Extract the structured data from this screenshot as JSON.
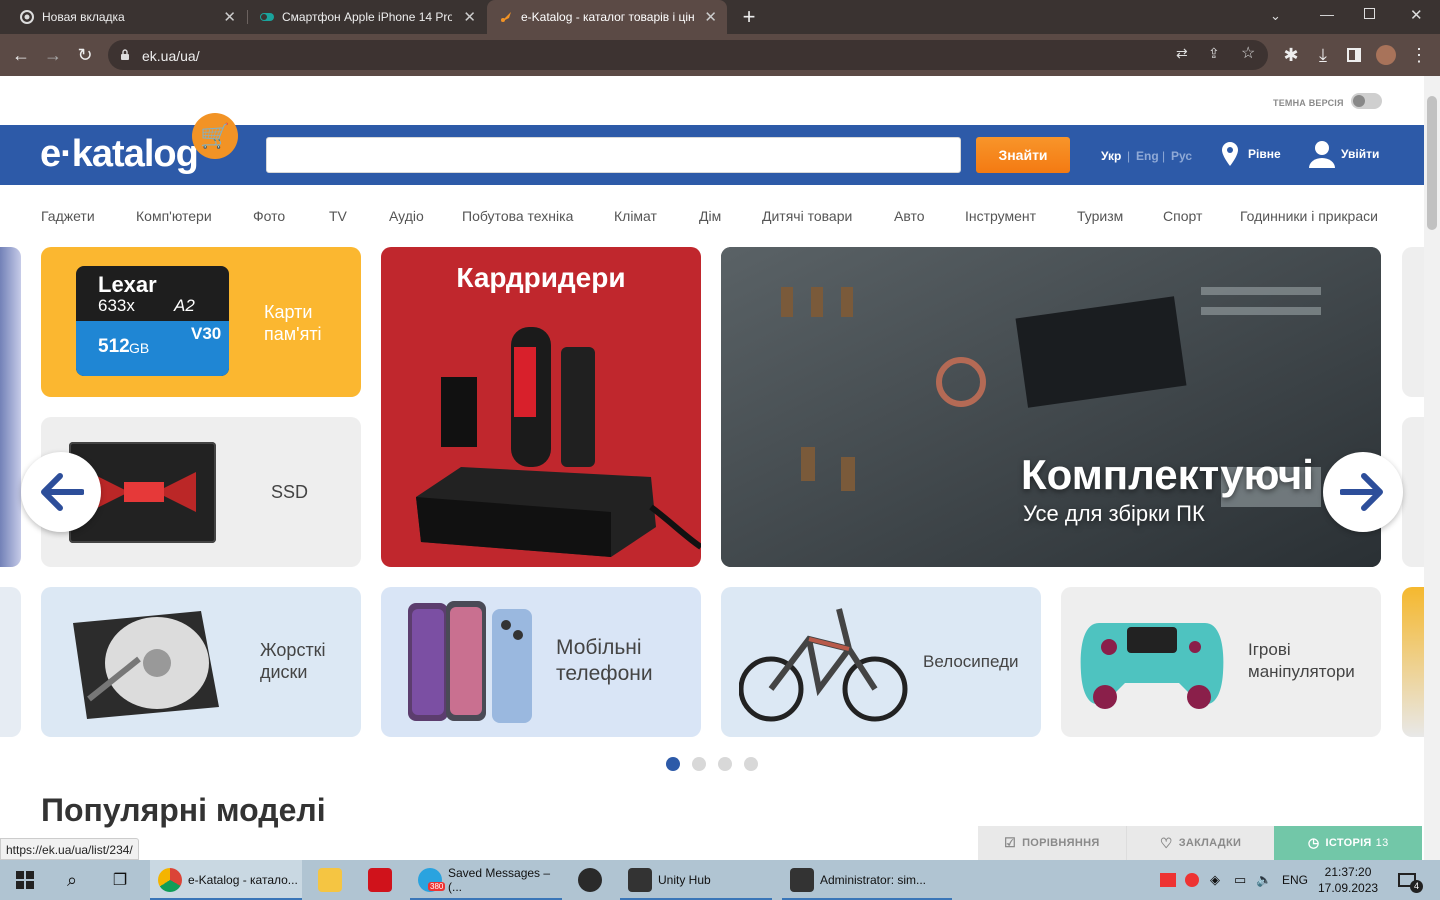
{
  "browser": {
    "tabs": [
      {
        "label": "Новая вкладка",
        "active": false
      },
      {
        "label": "Смартфон Apple iPhone 14 Pro",
        "active": false
      },
      {
        "label": "e-Katalog - каталог товарів і цін",
        "active": true
      }
    ],
    "url": "ek.ua/ua/",
    "status_url": "https://ek.ua/ua/list/234/"
  },
  "site": {
    "dark_mode_label": "ТЕМНА ВЕРСІЯ",
    "logo": "e·katalog",
    "search_placeholder": "",
    "find_button": "Знайти",
    "langs": [
      "Укр",
      "Eng",
      "Рус"
    ],
    "lang_sep": "|",
    "city": "Рівне",
    "login": "Увійти",
    "nav": [
      "Гаджети",
      "Комп'ютери",
      "Фото",
      "TV",
      "Аудіо",
      "Побутова техніка",
      "Клімат",
      "Дім",
      "Дитячі товари",
      "Авто",
      "Інструмент",
      "Туризм",
      "Спорт",
      "Годинники і прикраси"
    ],
    "cards": {
      "memory": "Карти пам'яті",
      "ssd": "SSD",
      "readers": "Кардридери",
      "components_title": "Комплектуючі",
      "components_sub": "Усе для збірки ПК",
      "hdd": "Жорсткі диски",
      "phones": "Мобільні телефони",
      "bikes": "Велосипеди",
      "gamepads": "Ігрові маніпулятори"
    },
    "sd_card_text": {
      "brand": "Lexar",
      "speed": "633x",
      "a2": "A2",
      "cap": "512",
      "gb": "GB",
      "v": "V30"
    },
    "slider_dots": 4,
    "slider_active": 1,
    "popular": "Популярні моделі",
    "bottombar": {
      "compare": "ПОРІВНЯННЯ",
      "bookmarks": "ЗАКЛАДКИ",
      "history": "ІСТОРІЯ",
      "history_count": "13"
    }
  },
  "taskbar": {
    "apps": [
      {
        "label": "e-Katalog - катало..."
      },
      {
        "label": "Saved Messages – (..."
      },
      {
        "label": "Unity Hub"
      },
      {
        "label": "Administrator: sim..."
      }
    ],
    "telegram_badge": "380",
    "lang": "ENG",
    "time": "21:37:20",
    "date": "17.09.2023",
    "notif_count": "4"
  },
  "colors": {
    "brand_blue": "#2d5aa8",
    "orange": "#f47a12",
    "history_green": "#72c7a8"
  }
}
